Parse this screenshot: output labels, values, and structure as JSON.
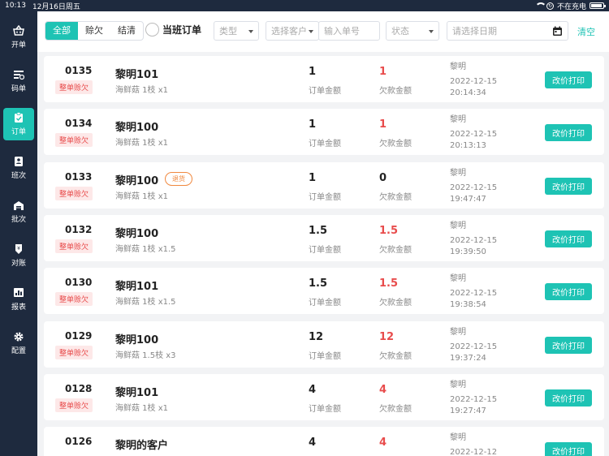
{
  "status_bar": {
    "time": "10:13",
    "date": "12月16日周五",
    "charging": "不在充电"
  },
  "sidebar": {
    "items": [
      {
        "label": "开单",
        "icon": "basket-icon"
      },
      {
        "label": "码单",
        "icon": "code-list-icon"
      },
      {
        "label": "订单",
        "icon": "clipboard-icon",
        "active": true
      },
      {
        "label": "班次",
        "icon": "shift-icon"
      },
      {
        "label": "批次",
        "icon": "warehouse-icon"
      },
      {
        "label": "对账",
        "icon": "reconcile-icon"
      },
      {
        "label": "报表",
        "icon": "report-icon"
      },
      {
        "label": "配置",
        "icon": "gear-icon"
      }
    ]
  },
  "toolbar": {
    "filters": [
      "全部",
      "赊欠",
      "结清"
    ],
    "active_filter": "全部",
    "current_shift_label": "当班订单",
    "type_placeholder": "类型",
    "customer_placeholder": "选择客户",
    "order_no_placeholder": "输入单号",
    "status_placeholder": "状态",
    "date_placeholder": "请选择日期",
    "clear_label": "清空"
  },
  "labels": {
    "amount": "订单金额",
    "debt": "欠款金额",
    "action": "改价打印"
  },
  "colors": {
    "accent": "#1ec3b4",
    "debt": "#e84c4c",
    "return": "#f0883e",
    "sidebar": "#1e2a3e"
  },
  "orders": [
    {
      "no": "0135",
      "badge": "整单赊欠",
      "customer": "黎明101",
      "return_tag": "",
      "item": "海鲜菇 1枝 x1",
      "amount": "1",
      "debt": "1",
      "operator": "黎明",
      "date": "2022-12-15",
      "time": "20:14:34"
    },
    {
      "no": "0134",
      "badge": "整单赊欠",
      "customer": "黎明100",
      "return_tag": "",
      "item": "海鲜菇 1枝 x1",
      "amount": "1",
      "debt": "1",
      "operator": "黎明",
      "date": "2022-12-15",
      "time": "20:13:13"
    },
    {
      "no": "0133",
      "badge": "整单赊欠",
      "customer": "黎明100",
      "return_tag": "退货",
      "item": "海鲜菇 1枝 x1",
      "amount": "1",
      "debt": "0",
      "operator": "黎明",
      "date": "2022-12-15",
      "time": "19:47:47"
    },
    {
      "no": "0132",
      "badge": "整单赊欠",
      "customer": "黎明100",
      "return_tag": "",
      "item": "海鲜菇 1枝 x1.5",
      "amount": "1.5",
      "debt": "1.5",
      "operator": "黎明",
      "date": "2022-12-15",
      "time": "19:39:50"
    },
    {
      "no": "0130",
      "badge": "整单赊欠",
      "customer": "黎明101",
      "return_tag": "",
      "item": "海鲜菇 1枝 x1.5",
      "amount": "1.5",
      "debt": "1.5",
      "operator": "黎明",
      "date": "2022-12-15",
      "time": "19:38:54"
    },
    {
      "no": "0129",
      "badge": "整单赊欠",
      "customer": "黎明100",
      "return_tag": "",
      "item": "海鲜菇 1.5枝 x3",
      "amount": "12",
      "debt": "12",
      "operator": "黎明",
      "date": "2022-12-15",
      "time": "19:37:24"
    },
    {
      "no": "0128",
      "badge": "整单赊欠",
      "customer": "黎明101",
      "return_tag": "",
      "item": "海鲜菇 1枝 x1",
      "amount": "4",
      "debt": "4",
      "operator": "黎明",
      "date": "2022-12-15",
      "time": "19:27:47"
    },
    {
      "no": "0126",
      "badge": "",
      "customer": "黎明的客户",
      "return_tag": "",
      "item": "",
      "amount": "4",
      "debt": "4",
      "operator": "黎明",
      "date": "2022-12-12",
      "time": ""
    }
  ]
}
